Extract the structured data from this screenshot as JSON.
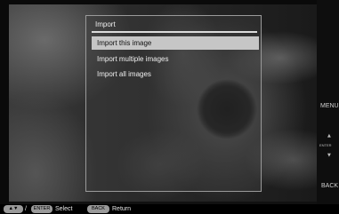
{
  "dialog": {
    "title": "Import",
    "items": [
      {
        "label": "Import this image",
        "selected": true
      },
      {
        "label": "Import multiple images",
        "selected": false
      },
      {
        "label": "Import all images",
        "selected": false
      }
    ]
  },
  "side_controls": {
    "menu_label": "MENU",
    "enter_label": "ENTER",
    "back_label": "BACK"
  },
  "guide_bar": {
    "arrows_icon": "up-down-arrows-icon",
    "arrows_glyph": "▲▼",
    "separator": "/",
    "enter_key": "ENTER",
    "select_label": "Select",
    "back_key": "BACK",
    "return_label": "Return"
  },
  "colors": {
    "selected_bg": "#c6c6c6",
    "pill_bg": "#9a9a9a"
  }
}
